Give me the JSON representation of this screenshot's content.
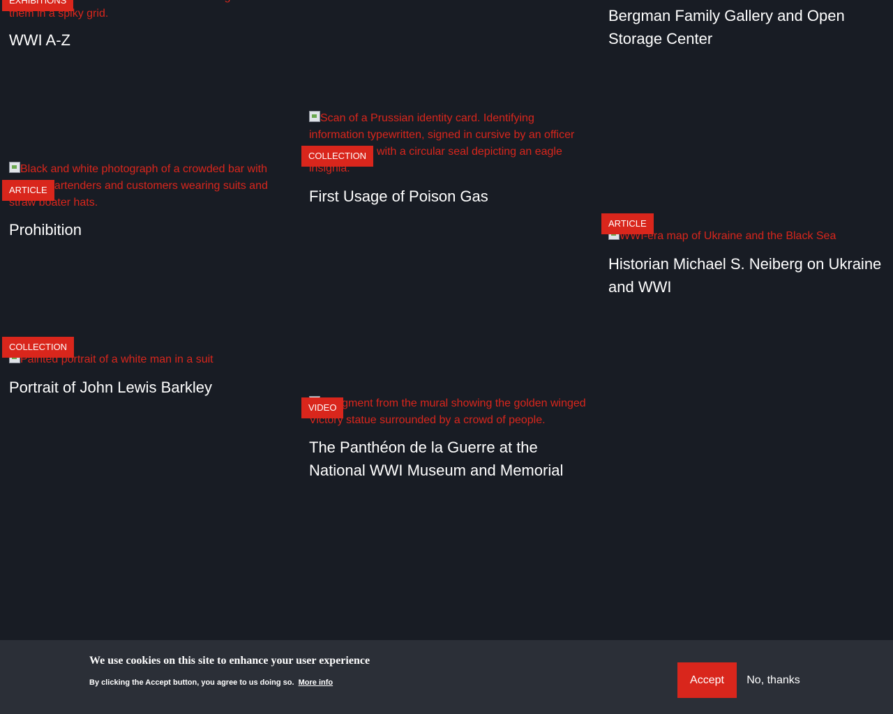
{
  "cards": [
    {
      "id": "wwi-az",
      "tag": "EXHIBITIONS",
      "alt": "... entanglements with barbed wire stretching between them in a spiky grid.",
      "title": "WWI A-Z"
    },
    {
      "id": "bergman",
      "title": "Bergman Family Gallery and Open Storage Center"
    },
    {
      "id": "poison-gas",
      "tag": "COLLECTION",
      "alt": "Scan of a Prussian identity card. Identifying information typewritten, signed in cursive by an officer and stamped with a circular seal depicting an eagle insignia.",
      "title": "First Usage of Poison Gas"
    },
    {
      "id": "prohibition",
      "tag": "ARTICLE",
      "alt": "Black and white photograph of a crowded bar with several bartenders and customers wearing suits and straw boater hats.",
      "title": "Prohibition"
    },
    {
      "id": "neiberg",
      "tag": "ARTICLE",
      "alt": "WWI-era map of Ukraine and the Black Sea",
      "title": "Historian Michael S. Neiberg on Ukraine and WWI"
    },
    {
      "id": "barkley",
      "tag": "COLLECTION",
      "alt": "Painted portrait of a white man in a suit",
      "title": "Portrait of John Lewis Barkley"
    },
    {
      "id": "pantheon",
      "tag": "VIDEO",
      "alt": "A segment from the mural showing the golden winged Victory statue surrounded by a crowd of people.",
      "title": "The Panthéon de la Guerre at the National WWI Museum and Memorial"
    }
  ],
  "cookie_banner": {
    "heading": "We use cookies on this site to enhance your user experience",
    "text": "By clicking the Accept button, you agree to us doing so.",
    "more_info": "More info",
    "accept": "Accept",
    "decline": "No, thanks"
  },
  "colors": {
    "background": "#181c24",
    "accent": "#d9261c",
    "banner": "#2b2f37"
  }
}
